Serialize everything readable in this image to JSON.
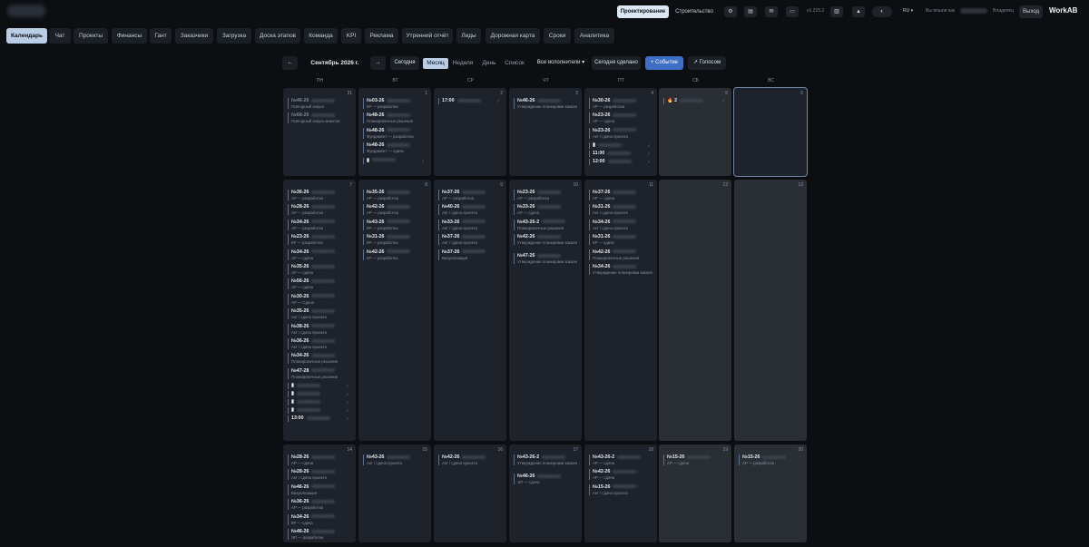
{
  "topbar": {
    "modes": [
      {
        "label": "Проектирование",
        "active": true
      },
      {
        "label": "Строительство",
        "active": false
      }
    ],
    "version": "v1.215.2",
    "lang": "RU",
    "user_prefix": "Вы вошли как",
    "role": "Владелец",
    "logout": "Выход",
    "brand": "WorkAB"
  },
  "nav": [
    "Календарь",
    "Чат",
    "Проекты",
    "Финансы",
    "Гант",
    "Заказчики",
    "Загрузка",
    "Доска этапов",
    "Команда",
    "KPI",
    "Реклама",
    "Утренний отчёт",
    "Лиды",
    "Дорожная карта",
    "Сроки",
    "Аналитика"
  ],
  "toolbar": {
    "prev": "←",
    "month": "Сентябрь 2026 г.",
    "next": "→",
    "today": "Сегодня",
    "views": [
      "Месяц",
      "Неделя",
      "День",
      "Список"
    ],
    "performers": "Все исполнители",
    "done_today": "Сегодня сделано",
    "add": "+ Событие",
    "voice": "↗ Голосом"
  },
  "days": [
    "ПН",
    "ВТ",
    "СР",
    "ЧТ",
    "ПТ",
    "СБ",
    "ВС"
  ],
  "weeks": [
    {
      "cells": [
        {
          "num": "31",
          "dim": true,
          "events": [
            {
              "code": "№46-26",
              "sub": "Повторный запуск"
            },
            {
              "code": "№68-26",
              "sub": "Повторный запуск макетов"
            }
          ]
        },
        {
          "num": "1",
          "events": [
            {
              "code": "№03-26",
              "sub": "КР — разработка"
            },
            {
              "code": "№48-26",
              "sub": "Планировочные решения"
            },
            {
              "code": "№48-26",
              "sub": "Фундамент — разработка"
            },
            {
              "code": "№48-26",
              "sub": "Фундамент — сдача"
            },
            {
              "code": "▮",
              "sub": ""
            }
          ]
        },
        {
          "num": "2",
          "events": [
            {
              "code": "17:00",
              "sub": ""
            }
          ]
        },
        {
          "num": "3",
          "events": [
            {
              "code": "№46-26",
              "sub": "Утверждение планировки заказчиком"
            }
          ]
        },
        {
          "num": "4",
          "events": [
            {
              "code": "№30-26",
              "sub": "АР — разработка"
            },
            {
              "code": "№23-26",
              "sub": "АР — сдача"
            },
            {
              "code": "№23-26",
              "sub": "Акт / сдача проекта"
            },
            {
              "code": "▮",
              "sub": ""
            },
            {
              "code": "11:00",
              "sub": ""
            },
            {
              "code": "12:00",
              "sub": ""
            }
          ]
        },
        {
          "num": "5",
          "weekend": true,
          "events": [
            {
              "code": "🔥 2",
              "sub": ""
            }
          ]
        },
        {
          "num": "6",
          "weekend": true,
          "today": true,
          "events": []
        }
      ]
    },
    {
      "cells": [
        {
          "num": "7",
          "events": [
            {
              "code": "№36-26",
              "sub": "АР — разработка"
            },
            {
              "code": "№28-26",
              "sub": "АР — разработка"
            },
            {
              "code": "№34-26",
              "sub": "АР — разработка"
            },
            {
              "code": "№23-26",
              "sub": "КР — разработка"
            },
            {
              "code": "№34-26",
              "sub": "АР — сдача"
            },
            {
              "code": "№35-26",
              "sub": "АР — сдача"
            },
            {
              "code": "№56-26",
              "sub": "АР — сдача"
            },
            {
              "code": "№30-26",
              "sub": "АР — Сдача"
            },
            {
              "code": "№35-26",
              "sub": "Акт / сдача проекта"
            },
            {
              "code": "№38-26",
              "sub": "Акт / сдача проекта"
            },
            {
              "code": "№36-26",
              "sub": "Акт / сдача проекта"
            },
            {
              "code": "№34-26",
              "sub": "Планировочные решения"
            },
            {
              "code": "№47-28",
              "sub": "Планировочные решения"
            },
            {
              "code": "▮",
              "sub": ""
            },
            {
              "code": "▮",
              "sub": ""
            },
            {
              "code": "▮",
              "sub": ""
            },
            {
              "code": "▮",
              "sub": ""
            },
            {
              "code": "13:00",
              "sub": ""
            }
          ]
        },
        {
          "num": "8",
          "events": [
            {
              "code": "№35-26",
              "sub": "АР — разработка"
            },
            {
              "code": "№42-26",
              "sub": "АР — разработка"
            },
            {
              "code": "№43-26",
              "sub": "КР — разработка"
            },
            {
              "code": "№31-26",
              "sub": "КР — разработка"
            },
            {
              "code": "№42-26",
              "sub": "КР — разработка"
            }
          ]
        },
        {
          "num": "9",
          "events": [
            {
              "code": "№37-26",
              "sub": "АР — разработка"
            },
            {
              "code": "№40-26",
              "sub": "Акт / сдача проекта"
            },
            {
              "code": "№33-26",
              "sub": "Акт / сдача проекта"
            },
            {
              "code": "№37-26",
              "sub": "Акт / сдача проекта"
            },
            {
              "code": "№37-26",
              "sub": "Визуализация"
            }
          ]
        },
        {
          "num": "10",
          "events": [
            {
              "code": "№23-26",
              "sub": "АР — разработка"
            },
            {
              "code": "№33-26",
              "sub": "АР — сдача"
            },
            {
              "code": "№43-26-2",
              "sub": "Планировочные решения"
            },
            {
              "code": "№42-26",
              "sub": "Утверждение планировки заказчиком"
            },
            {
              "code": "№47-26",
              "sub": "Утверждение планировки заказчиком"
            }
          ]
        },
        {
          "num": "11",
          "events": [
            {
              "code": "№37-26",
              "sub": "АР — сдача"
            },
            {
              "code": "№31-26",
              "sub": "Акт / сдача проекта"
            },
            {
              "code": "№34-26",
              "sub": "Акт / сдача проекта"
            },
            {
              "code": "№31-26",
              "sub": "КР — сдача"
            },
            {
              "code": "№42-26",
              "sub": "Планировочные решения"
            },
            {
              "code": "№34-26",
              "sub": "Утверждение планировки заказчиком"
            }
          ]
        },
        {
          "num": "12",
          "weekend": true,
          "events": []
        },
        {
          "num": "13",
          "weekend": true,
          "events": []
        }
      ]
    },
    {
      "cells": [
        {
          "num": "14",
          "events": [
            {
              "code": "№28-26",
              "sub": "АР — сдача"
            },
            {
              "code": "№28-26",
              "sub": "Акт / сдача проекта"
            },
            {
              "code": "№46-26",
              "sub": "Визуализация"
            },
            {
              "code": "№36-26",
              "sub": "АР — разработка"
            },
            {
              "code": "№34-26",
              "sub": "КР — сдача"
            },
            {
              "code": "№46-26",
              "sub": "ЭП — разработка"
            }
          ]
        },
        {
          "num": "15",
          "events": [
            {
              "code": "№43-26",
              "sub": "Акт / сдача проекта"
            }
          ]
        },
        {
          "num": "16",
          "events": [
            {
              "code": "№42-26",
              "sub": "Акт / сдача проекта"
            }
          ]
        },
        {
          "num": "17",
          "events": [
            {
              "code": "№43-26-2",
              "sub": "Утверждение планировки заказчиком"
            },
            {
              "code": "№46-26",
              "sub": "ЭП — сдача"
            }
          ]
        },
        {
          "num": "18",
          "events": [
            {
              "code": "№43-26-2",
              "sub": "АР — сдача"
            },
            {
              "code": "№42-26",
              "sub": "АР — сдача"
            },
            {
              "code": "№15-26",
              "sub": "Акт / сдача проекта"
            }
          ]
        },
        {
          "num": "19",
          "weekend": true,
          "events": [
            {
              "code": "№15-26",
              "sub": "АР — сдача"
            }
          ]
        },
        {
          "num": "20",
          "weekend": true,
          "events": [
            {
              "code": "№15-26",
              "sub": "АР — разработка"
            }
          ]
        }
      ]
    }
  ]
}
